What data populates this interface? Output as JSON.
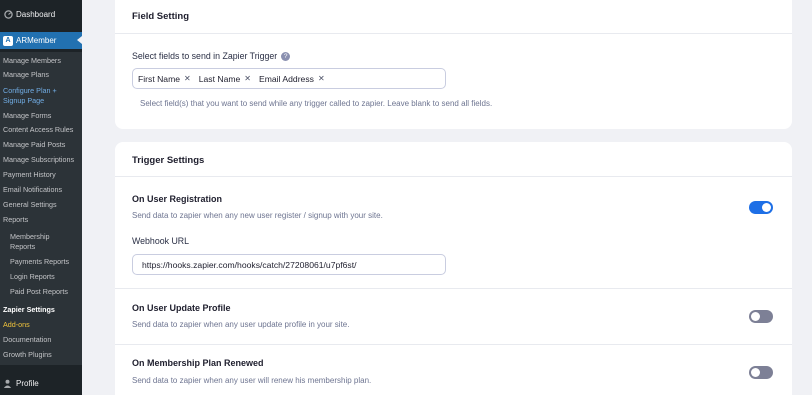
{
  "sidebar": {
    "dashboard": "Dashboard",
    "plugin": "ARMember",
    "items": [
      {
        "label": "Manage Members",
        "style": ""
      },
      {
        "label": "Manage Plans",
        "style": ""
      },
      {
        "label": "Configure Plan +",
        "style": "hl"
      },
      {
        "label": "Signup Page",
        "style": "hl"
      },
      {
        "label": "Manage Forms",
        "style": ""
      },
      {
        "label": "Content Access Rules",
        "style": ""
      },
      {
        "label": "Manage Paid Posts",
        "style": ""
      },
      {
        "label": "Manage Subscriptions",
        "style": ""
      },
      {
        "label": "Payment History",
        "style": ""
      },
      {
        "label": "Email Notifications",
        "style": ""
      },
      {
        "label": "General Settings",
        "style": ""
      },
      {
        "label": "Reports",
        "style": ""
      },
      {
        "label": "Membership",
        "style": "indent"
      },
      {
        "label": "Reports",
        "style": "indent"
      },
      {
        "label": "Payments Reports",
        "style": "indent"
      },
      {
        "label": "Login Reports",
        "style": "indent"
      },
      {
        "label": "Paid Post Reports",
        "style": "indent"
      },
      {
        "label": "Zapier Settings",
        "style": "bold"
      },
      {
        "label": "Add-ons",
        "style": "yellow"
      },
      {
        "label": "Documentation",
        "style": ""
      },
      {
        "label": "Growth Plugins",
        "style": ""
      }
    ],
    "profile": "Profile"
  },
  "field_setting": {
    "title": "Field Setting",
    "select_label": "Select fields to send in Zapier Trigger",
    "tags": [
      "First Name",
      "Last Name",
      "Email Address"
    ],
    "help": "Select field(s) that you want to send while any trigger called to zapier. Leave blank to send all fields."
  },
  "trigger_settings": {
    "title": "Trigger Settings",
    "registration": {
      "title": "On User Registration",
      "desc": "Send data to zapier when any new user register / signup with your site.",
      "enabled": true,
      "webhook_label": "Webhook URL",
      "webhook_url": "https://hooks.zapier.com/hooks/catch/27208061/u7pf6st/"
    },
    "update_profile": {
      "title": "On User Update Profile",
      "desc": "Send data to zapier when any user update profile in your site.",
      "enabled": false
    },
    "plan_renewed": {
      "title": "On Membership Plan Renewed",
      "desc": "Send data to zapier when any user will renew his membership plan.",
      "enabled": false
    }
  },
  "colors": {
    "sidebar_bg": "#1d2327",
    "submenu_bg": "#2c3338",
    "active": "#2271b1",
    "toggle_on": "#1e6fe6",
    "toggle_off": "#7d8096",
    "page_bg": "#f0f1f5"
  }
}
